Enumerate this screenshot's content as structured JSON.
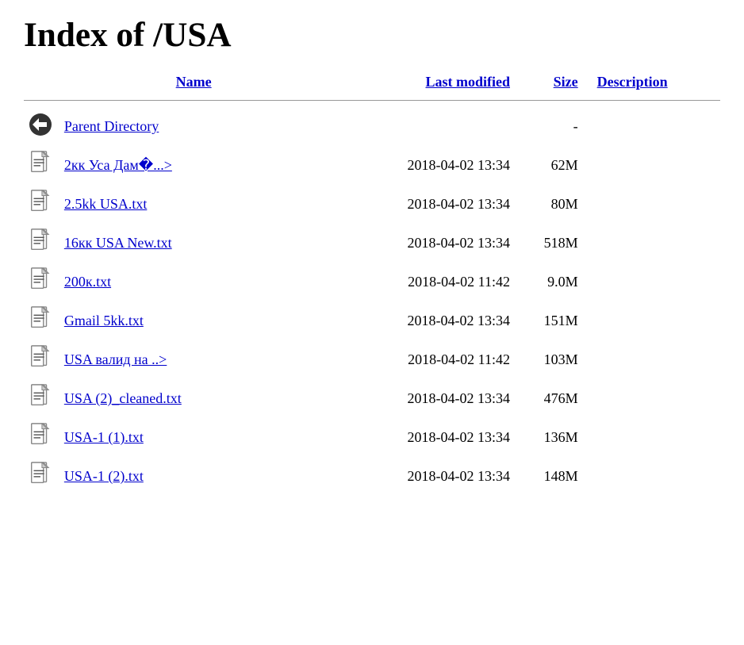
{
  "title": "Index of /USA",
  "columns": {
    "name": "Name",
    "modified": "Last modified",
    "size": "Size",
    "description": "Description"
  },
  "entries": [
    {
      "type": "parent",
      "name": "Parent Directory",
      "href": "/",
      "modified": "",
      "size": "-",
      "description": ""
    },
    {
      "type": "file",
      "name": "2кк Уса Дам�...>",
      "href": "#",
      "modified": "2018-04-02 13:34",
      "size": "62M",
      "description": ""
    },
    {
      "type": "file",
      "name": "2.5kk USA.txt",
      "href": "#",
      "modified": "2018-04-02 13:34",
      "size": "80M",
      "description": ""
    },
    {
      "type": "file",
      "name": "16кк USA New.txt",
      "href": "#",
      "modified": "2018-04-02 13:34",
      "size": "518M",
      "description": ""
    },
    {
      "type": "file",
      "name": "200к.txt",
      "href": "#",
      "modified": "2018-04-02 11:42",
      "size": "9.0M",
      "description": ""
    },
    {
      "type": "file",
      "name": "Gmail 5kk.txt",
      "href": "#",
      "modified": "2018-04-02 13:34",
      "size": "151M",
      "description": ""
    },
    {
      "type": "file",
      "name": "USA валид на ..>",
      "href": "#",
      "modified": "2018-04-02 11:42",
      "size": "103M",
      "description": ""
    },
    {
      "type": "file",
      "name": "USA (2)_cleaned.txt",
      "href": "#",
      "modified": "2018-04-02 13:34",
      "size": "476M",
      "description": ""
    },
    {
      "type": "file",
      "name": "USA-1 (1).txt",
      "href": "#",
      "modified": "2018-04-02 13:34",
      "size": "136M",
      "description": ""
    },
    {
      "type": "file",
      "name": "USA-1 (2).txt",
      "href": "#",
      "modified": "2018-04-02 13:34",
      "size": "148M",
      "description": ""
    }
  ]
}
